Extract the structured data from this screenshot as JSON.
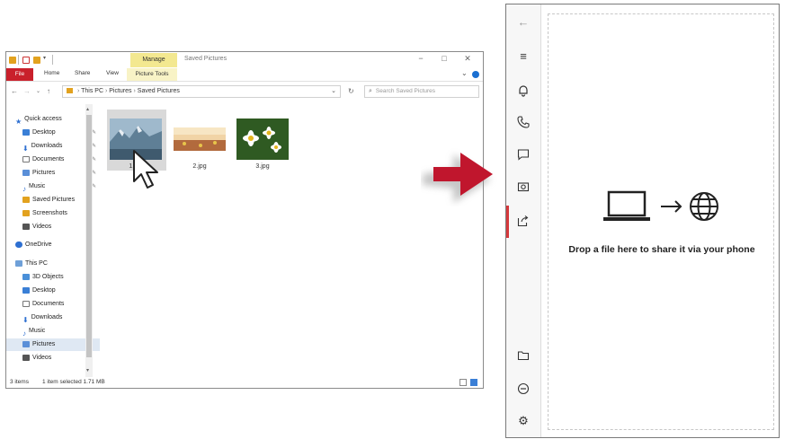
{
  "explorer": {
    "title": "Saved Pictures",
    "manage_label": "Manage",
    "picture_tools_label": "Picture Tools",
    "ribbon_tabs": [
      "File",
      "Home",
      "Share",
      "View"
    ],
    "address": {
      "path": [
        "This PC",
        "Pictures",
        "Saved Pictures"
      ],
      "search_placeholder": "Search Saved Pictures"
    },
    "nav": {
      "quick_access_label": "Quick access",
      "quick_items": [
        "Desktop",
        "Downloads",
        "Documents",
        "Pictures",
        "Music",
        "Saved Pictures",
        "Screenshots",
        "Videos"
      ],
      "onedrive_label": "OneDrive",
      "thispc_label": "This PC",
      "pc_items": [
        "3D Objects",
        "Desktop",
        "Documents",
        "Downloads",
        "Music",
        "Pictures",
        "Videos"
      ],
      "selected_item": "Pictures"
    },
    "files": [
      {
        "name": "1.jpg"
      },
      {
        "name": "2.jpg"
      },
      {
        "name": "3.jpg"
      }
    ],
    "status": {
      "items": "3 items",
      "selection": "1 item selected  1.71 MB"
    }
  },
  "phone": {
    "drop_text": "Drop a file here to share it via your phone",
    "rail_icons": [
      "back-arrow-icon",
      "menu-icon",
      "bell-icon",
      "phone-icon",
      "message-icon",
      "photo-icon",
      "share-icon",
      "folder-icon",
      "minus-circle-icon",
      "gear-icon"
    ]
  },
  "colors": {
    "accent_red": "#c9202b",
    "manage_yellow": "#f3e890",
    "arrow_red": "#c0162d"
  }
}
